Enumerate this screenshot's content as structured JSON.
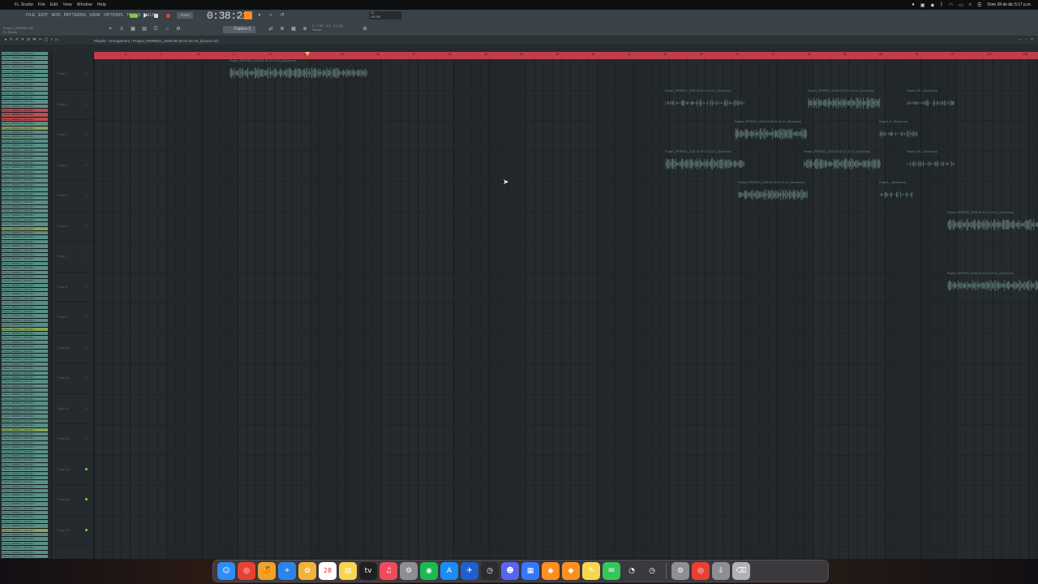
{
  "menubar": {
    "app_menus": [
      "FL Studio",
      "File",
      "Edit",
      "View",
      "Window",
      "Help"
    ],
    "clock": "Dom 28 de dic 5:17 p.m."
  },
  "toolbar": {
    "menus": [
      "FILE",
      "EDIT",
      "ADD",
      "PATTERNS",
      "VIEW",
      "OPTIONS",
      "TOOLS",
      "HELP"
    ],
    "song_mode": "SONG",
    "time": "0:38:21",
    "time_sub": "M:S:CS",
    "pattern": "Pattern 5",
    "project_line1": "Project_PERREO.flp",
    "project_line2": "FL Studio",
    "cpu_line1": "28",
    "cpu_line2": "456 MB",
    "hint_line1": "0 - 7:50 - 0:1 - 0:0 (3)",
    "hint_line2": "Stroke"
  },
  "playlist": {
    "title": "Playlist - Arrangement › Project_PERREO_2025-09-30 01-02-10_(Dcomi loz)"
  },
  "picker": {
    "items": [
      "Project_PERREO_2025-09-3",
      "Project_PERREO_2025-09-3",
      "Project_PERREO_2025-09-3",
      "Project_PERREO_2025-09-3",
      "Project_PERREO_2025-09-3",
      "Project_PERREO_2025-09-3",
      "Project_PERREO_2025-09-3",
      "Project_PERREO_2025-09-3",
      "Project_PERREO_2025-09-3",
      "Project_PERREO_2025-09-3",
      "Project_PERREO_2025-09-3",
      "Project_PERREO_2025-09-3",
      "Project_PERREO_2025-09-3",
      "Project_PERREO_2025-09-3",
      "Project_PERREO_2025-09-3",
      "Project_PERREO_2025-09-3"
    ]
  },
  "tracks": [
    {
      "name": "Track 1"
    },
    {
      "name": "Track 2"
    },
    {
      "name": "Track 3"
    },
    {
      "name": "Track 4"
    },
    {
      "name": "Track 5"
    },
    {
      "name": "Track 6"
    },
    {
      "name": "Track 7"
    },
    {
      "name": "Track 8"
    },
    {
      "name": "Track 9"
    },
    {
      "name": "Track 10"
    },
    {
      "name": "Track 11"
    },
    {
      "name": "Track 12"
    },
    {
      "name": "Track 13"
    },
    {
      "name": "Track 14"
    },
    {
      "name": "Track 15"
    },
    {
      "name": "Track 16"
    }
  ],
  "timeline": {
    "ticks": [
      "5",
      "9",
      "13",
      "17",
      "21",
      "25",
      "29",
      "33",
      "37",
      "41",
      "45",
      "49",
      "53",
      "57",
      "61",
      "65",
      "69",
      "73",
      "77",
      "81",
      "85",
      "89",
      "93",
      "97",
      "101",
      "105",
      "109"
    ]
  },
  "clips": [
    {
      "label": "Project_PERREO_2025-09-30 01-02-10_(Dcomi loz)"
    },
    {
      "label": "Project_PERREO_2025-09-30 01-02-10_(Dcomi loz)"
    },
    {
      "label": "Project_PERREO_2025-09-30 01-02-10_(Dcomi loz)"
    },
    {
      "label": "Project_PE...(Dcomi loz)"
    },
    {
      "label": "Project_PERREO_2025-09-30 01-02-10_(Dcomi loz)"
    },
    {
      "label": "Project_P...(Dcomi loz)"
    },
    {
      "label": "Project_PERREO_2025-09-30 01-02-10_(Dcomi loz)"
    },
    {
      "label": "Project_PERREO_2025-09-30 01-02-10_(Dcomi loz)"
    },
    {
      "label": "Project_PE...(Dcomi loz)"
    },
    {
      "label": "Project_PERREO_2025-09-30 01-02-10_(Dcomi loz)"
    },
    {
      "label": "Project_...(Dcomi loz)"
    },
    {
      "label": "Project_PERREO_2025-09-30 01-02-10_(Dcomi loz)"
    },
    {
      "label": "Project_PERREO_2025-09-30 01-02-10_(Dcomi loz)"
    }
  ],
  "dock": {
    "apps": [
      "Finder",
      "Chrome",
      "FL",
      "Safari",
      "Photos",
      "Calendar",
      "Notes",
      "TV",
      "Music",
      "Settings",
      "Spotify",
      "App Store",
      "Store",
      "Dashboard",
      "Discord",
      "Files",
      "FL Studio",
      "FL Studio 2",
      "Notes 2",
      "Messages",
      "Activity",
      "Clock",
      "Preferences",
      "Chrome 2",
      "Downloads",
      "Trash"
    ],
    "calendar_day": "28"
  },
  "colors": {
    "timeline": "#c23d4b",
    "clip_label": "#5e8f8a",
    "picker_teal": "#5a8e86",
    "picker_red": "#b84f55",
    "track_led": "#7ed22d"
  }
}
